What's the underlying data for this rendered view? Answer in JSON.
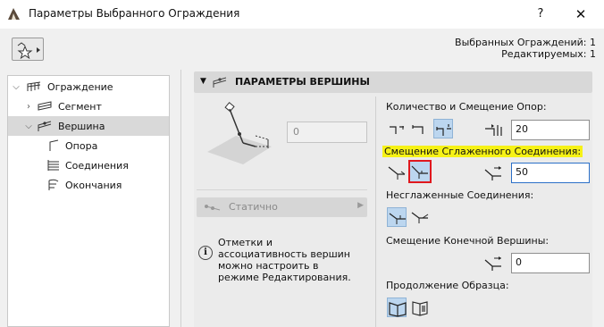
{
  "window": {
    "title": "Параметры Выбранного Ограждения",
    "help": "?",
    "close": "✕"
  },
  "header": {
    "selected": "Выбранных Ограждений: 1",
    "editable": "Редактируемых: 1"
  },
  "tree": [
    {
      "label": "Ограждение",
      "icon": "railing-icon"
    },
    {
      "label": "Сегмент",
      "icon": "segment-icon"
    },
    {
      "label": "Вершина",
      "icon": "node-icon"
    },
    {
      "label": "Опора",
      "icon": "post-icon"
    },
    {
      "label": "Соединения",
      "icon": "connections-icon"
    },
    {
      "label": "Окончания",
      "icon": "endings-icon"
    }
  ],
  "panel": {
    "title": "ПАРАМЕТРЫ ВЕРШИНЫ",
    "value": "0",
    "static_label": "Статично",
    "info": "Отметки и ассоциативность вершин можно настроить в режиме Редактирования.",
    "posts_label": "Количество и Смещение Опор:",
    "posts_value": "20",
    "smooth_label": "Смещение Сглаженного Соединения:",
    "smooth_value": "50",
    "unsmooth_label": "Несглаженные Соединения:",
    "end_label": "Смещение Конечной Вершины:",
    "end_value": "0",
    "pattern_label": "Продолжение Образца:"
  }
}
